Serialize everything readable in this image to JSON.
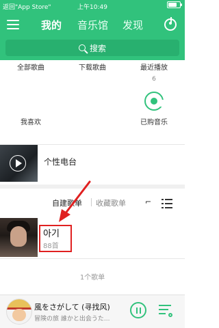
{
  "status": {
    "back_label": "返回\"App Store\"",
    "time": "上午10:49"
  },
  "nav": {
    "tabs": [
      "我的",
      "音乐馆",
      "发现"
    ]
  },
  "search": {
    "placeholder": "搜索"
  },
  "grid": {
    "local": "全部歌曲",
    "downloaded": "下载歌曲",
    "recent": "最近播放",
    "recent_count": "6",
    "liked": "我喜欢",
    "purchased": "已购音乐"
  },
  "personal": {
    "label": "个性电台"
  },
  "playlist_tabs": {
    "created": "自建歌单",
    "collected": "收藏歌单"
  },
  "playlist": {
    "title": "아기",
    "subtitle": "88首"
  },
  "summary": {
    "count": "1个歌单"
  },
  "player": {
    "song": "風をさがして (寻找风)",
    "lyric": "冒険の旅 誰かと出会うた..."
  },
  "colors": {
    "accent": "#31c27c",
    "highlight": "#e02020"
  }
}
